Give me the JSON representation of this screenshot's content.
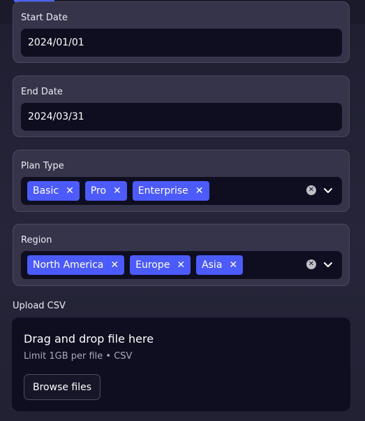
{
  "start_date": {
    "label": "Start Date",
    "value": "2024/01/01"
  },
  "end_date": {
    "label": "End Date",
    "value": "2024/03/31"
  },
  "plan_type": {
    "label": "Plan Type",
    "tags": [
      "Basic",
      "Pro",
      "Enterprise"
    ],
    "tag_remove_symbol": "✕"
  },
  "region": {
    "label": "Region",
    "tags": [
      "North America",
      "Europe",
      "Asia"
    ],
    "tag_remove_symbol": "✕"
  },
  "upload": {
    "label": "Upload CSV",
    "title": "Drag and drop file here",
    "limit": "Limit 1GB per file • CSV",
    "button_label": "Browse files"
  },
  "colors": {
    "accent": "#4c5bff",
    "field_bg": "#0f0e21",
    "card_bg": "#35344a"
  },
  "icons": {
    "tag_remove": "close-icon",
    "clear_all": "clear-circle-icon",
    "dropdown": "chevron-down-icon"
  }
}
